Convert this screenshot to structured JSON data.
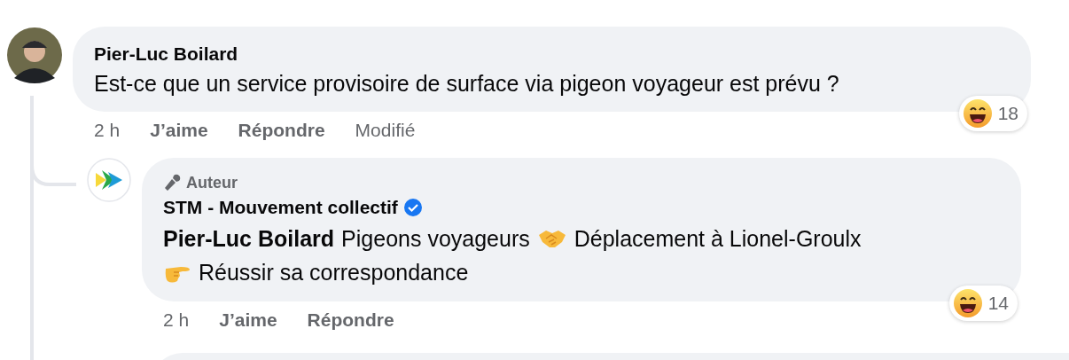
{
  "comment": {
    "author": "Pier-Luc Boilard",
    "text": "Est-ce que un service provisoire de surface via pigeon voyageur est prévu ?",
    "reaction_count": "18",
    "actions": [
      {
        "kind": "time",
        "label": "2 h"
      },
      {
        "kind": "button",
        "label": "J’aime"
      },
      {
        "kind": "button",
        "label": "Répondre"
      },
      {
        "kind": "note",
        "label": "Modifié"
      }
    ]
  },
  "reply": {
    "badge": "Auteur",
    "author": "STM - Mouvement collectif",
    "verified": true,
    "body": [
      {
        "kind": "mention",
        "text": "Pier-Luc Boilard"
      },
      {
        "kind": "text",
        "text": "Pigeons voyageurs"
      },
      {
        "kind": "handshake"
      },
      {
        "kind": "text",
        "text": "Déplacement à Lionel-Groulx"
      },
      {
        "kind": "break"
      },
      {
        "kind": "pointing"
      },
      {
        "kind": "text",
        "text": "Réussir sa correspondance"
      }
    ],
    "reaction_count": "14",
    "actions": [
      {
        "kind": "time",
        "label": "2 h"
      },
      {
        "kind": "button",
        "label": "J’aime"
      },
      {
        "kind": "button",
        "label": "Répondre"
      }
    ]
  }
}
